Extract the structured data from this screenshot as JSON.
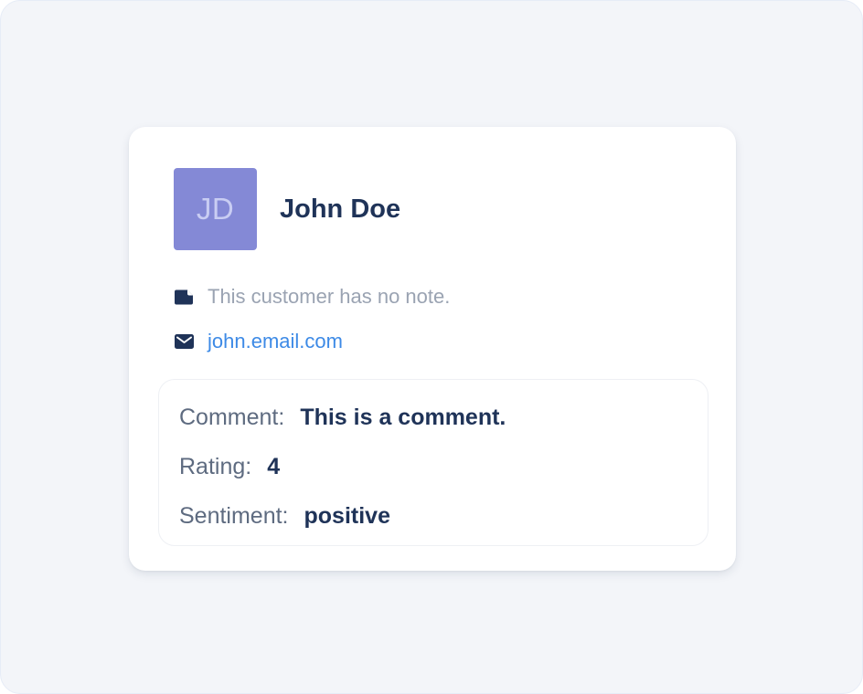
{
  "colors": {
    "avatar_bg": "#8489d6",
    "avatar_text": "#c9cdf3",
    "name_text": "#1f3358",
    "icon": "#1f3358",
    "note_text": "#9aa3b2",
    "email_link": "#3d8ae6",
    "label_text": "#5e6b80",
    "value_text": "#1f3358"
  },
  "customer": {
    "initials": "JD",
    "name": "John Doe",
    "note": "This customer has no note.",
    "email": "john.email.com",
    "note_icon": "note-icon",
    "email_icon": "mail-icon"
  },
  "details": {
    "comment_label": "Comment:",
    "comment_value": "This is a comment.",
    "rating_label": "Rating:",
    "rating_value": "4",
    "sentiment_label": "Sentiment:",
    "sentiment_value": "positive"
  }
}
